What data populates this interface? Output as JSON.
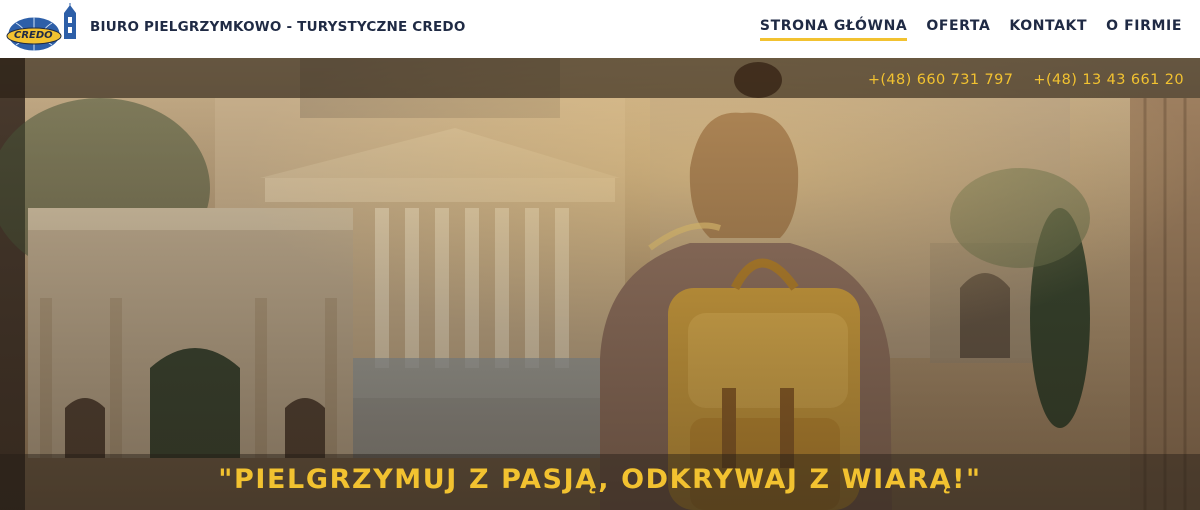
{
  "header": {
    "logo_text": "CREDO",
    "brand_name": "BIURO PIELGRZYMKOWO - TURYSTYCZNE CREDO",
    "nav": [
      {
        "label": "STRONA GŁÓWNA",
        "active": true
      },
      {
        "label": "OFERTA",
        "active": false
      },
      {
        "label": "KONTAKT",
        "active": false
      },
      {
        "label": "O FIRMIE",
        "active": false
      }
    ]
  },
  "hero": {
    "phones": [
      "+(48) 660 731 797",
      "+(48) 13 43 661 20"
    ],
    "slogan": "\"PIELGRZYMUJ Z PASJĄ, ODKRYWAJ Z WIARĄ!\""
  },
  "colors": {
    "accent": "#f2c230",
    "nav_text": "#1f2a44",
    "header_bg": "#ffffff"
  },
  "icons": [
    "credo-globe-logo"
  ]
}
